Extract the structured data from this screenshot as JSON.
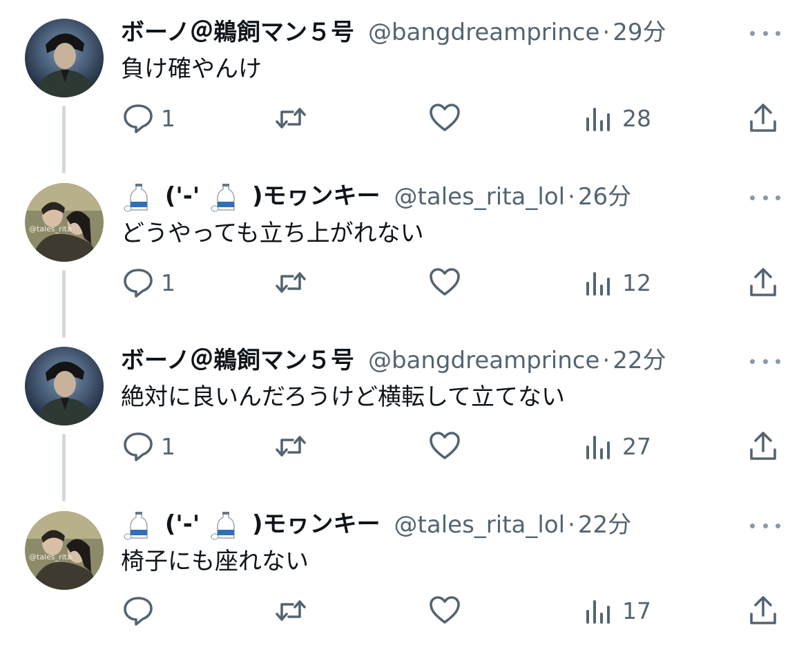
{
  "tweets": [
    {
      "display_name": "ボーノ＠鵜飼マン５号",
      "handle": "@bangdreamprince",
      "separator": "·",
      "time": "29分",
      "text": "負け確やんけ",
      "replies": "1",
      "retweets": "",
      "likes": "",
      "views": "28",
      "avatar": "avatar-boono"
    },
    {
      "display_name_parts": [
        "('-'",
        ")モヮンキー"
      ],
      "emoji": "sake-bottle-icon",
      "handle": "@tales_rita_lol",
      "separator": "·",
      "time": "26分",
      "text": "どうやっても立ち上がれない",
      "replies": "1",
      "retweets": "",
      "likes": "",
      "views": "12",
      "avatar": "avatar-monkey"
    },
    {
      "display_name": "ボーノ＠鵜飼マン５号",
      "handle": "@bangdreamprince",
      "separator": "·",
      "time": "22分",
      "text": "絶対に良いんだろうけど横転して立てない",
      "replies": "1",
      "retweets": "",
      "likes": "",
      "views": "27",
      "avatar": "avatar-boono"
    },
    {
      "display_name_parts": [
        "('-'",
        ")モヮンキー"
      ],
      "emoji": "sake-bottle-icon",
      "handle": "@tales_rita_lol",
      "separator": "·",
      "time": "22分",
      "text": "椅子にも座れない",
      "replies": "",
      "retweets": "",
      "likes": "",
      "views": "17",
      "avatar": "avatar-monkey"
    }
  ],
  "colors": {
    "text": "#0f1419",
    "secondary": "#536471",
    "thread_line": "#cfd9de",
    "more_dots": "#8b98a5"
  }
}
